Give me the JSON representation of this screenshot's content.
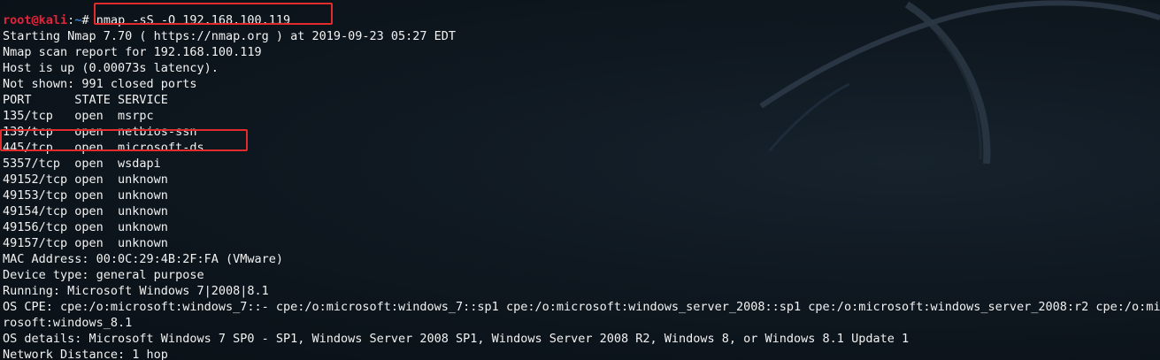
{
  "prompt": {
    "user_host": "root@kali",
    "sep": ":",
    "path": "~",
    "symbol": "# ",
    "command": "nmap -sS -O 192.168.100.119"
  },
  "output": [
    "Starting Nmap 7.70 ( https://nmap.org ) at 2019-09-23 05:27 EDT",
    "Nmap scan report for 192.168.100.119",
    "Host is up (0.00073s latency).",
    "Not shown: 991 closed ports",
    "PORT      STATE SERVICE",
    "135/tcp   open  msrpc",
    "139/tcp   open  netbios-ssn",
    "445/tcp   open  microsoft-ds",
    "5357/tcp  open  wsdapi",
    "49152/tcp open  unknown",
    "49153/tcp open  unknown",
    "49154/tcp open  unknown",
    "49156/tcp open  unknown",
    "49157/tcp open  unknown",
    "MAC Address: 00:0C:29:4B:2F:FA (VMware)",
    "Device type: general purpose",
    "Running: Microsoft Windows 7|2008|8.1",
    "OS CPE: cpe:/o:microsoft:windows_7::- cpe:/o:microsoft:windows_7::sp1 cpe:/o:microsoft:windows_server_2008::sp1 cpe:/o:microsoft:windows_server_2008:r2 cpe:/o:mic",
    "rosoft:windows_8.1",
    "OS details: Microsoft Windows 7 SP0 - SP1, Windows Server 2008 SP1, Windows Server 2008 R2, Windows 8, or Windows 8.1 Update 1",
    "Network Distance: 1 hop"
  ],
  "colors": {
    "background": "#0b1117",
    "text": "#f2f2f2",
    "prompt_user": "#e0243a",
    "prompt_path": "#3a7bd5",
    "highlight_box": "#e22b2b"
  }
}
